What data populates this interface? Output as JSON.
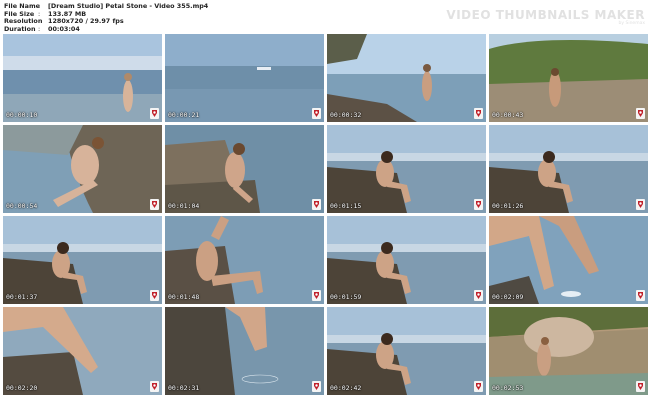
{
  "header": {
    "fields": [
      {
        "key": "File Name",
        "sep": ":",
        "value": "[Dream Studio] Petal Stone - Video 355.mp4"
      },
      {
        "key": "File Size",
        "sep": ":",
        "value": "133.87 MB"
      },
      {
        "key": "Resolution",
        "sep": ":",
        "value": "1280x720 / 29.97 fps"
      },
      {
        "key": "Duration",
        "sep": ":",
        "value": "00:03:04"
      }
    ],
    "brand_title": "VIDEO THUMBNAILS MAKER",
    "brand_sub": "by Sinemax"
  },
  "thumbnails": [
    {
      "timestamp": "00:00:10",
      "scene": "sea"
    },
    {
      "timestamp": "00:00:21",
      "scene": "sea-boat"
    },
    {
      "timestamp": "00:00:32",
      "scene": "shore-tree"
    },
    {
      "timestamp": "00:00:43",
      "scene": "rocks-green"
    },
    {
      "timestamp": "00:00:54",
      "scene": "rocks-close"
    },
    {
      "timestamp": "00:01:04",
      "scene": "rock-sit"
    },
    {
      "timestamp": "00:01:15",
      "scene": "rock-sit-dark"
    },
    {
      "timestamp": "00:01:26",
      "scene": "rock-sit-dark"
    },
    {
      "timestamp": "00:01:37",
      "scene": "rock-sit-dark"
    },
    {
      "timestamp": "00:01:48",
      "scene": "rock-lean"
    },
    {
      "timestamp": "00:01:59",
      "scene": "rock-sit-dark"
    },
    {
      "timestamp": "00:02:09",
      "scene": "legs-splash"
    },
    {
      "timestamp": "00:02:20",
      "scene": "legs-rock"
    },
    {
      "timestamp": "00:02:31",
      "scene": "feet-water"
    },
    {
      "timestamp": "00:02:42",
      "scene": "rock-sit-dark"
    },
    {
      "timestamp": "00:02:53",
      "scene": "rocks-pale"
    }
  ]
}
